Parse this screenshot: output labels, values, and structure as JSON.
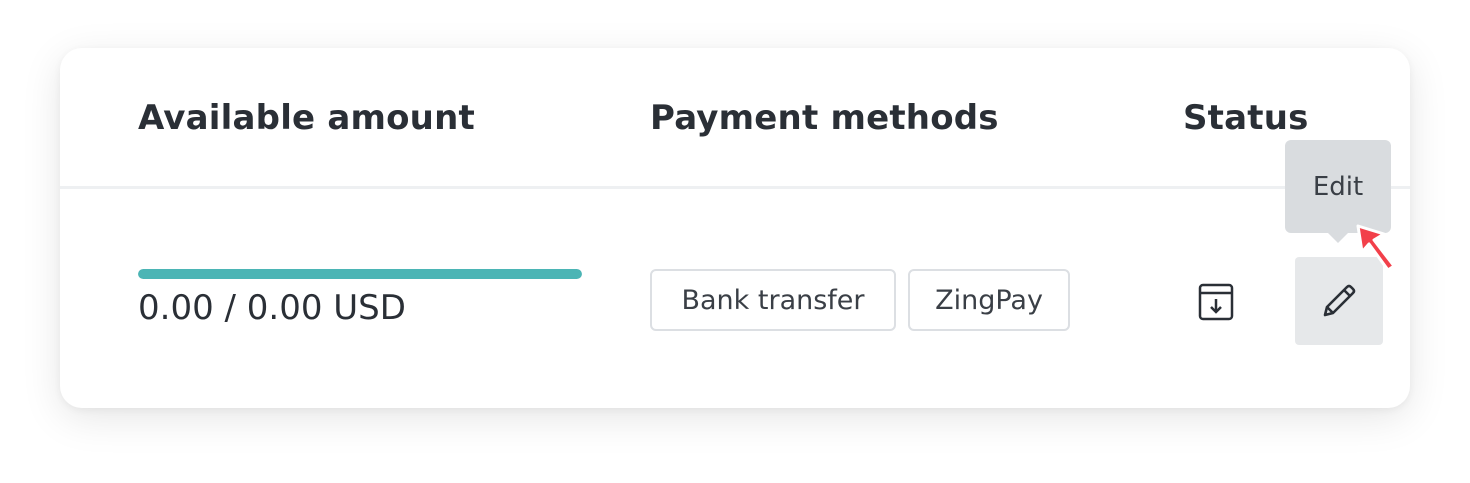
{
  "table": {
    "headers": {
      "amount": "Available amount",
      "methods": "Payment methods",
      "status": "Status"
    },
    "row": {
      "amount_text": "0.00 / 0.00 USD",
      "amount_progress_percent": 100,
      "payment_methods": [
        "Bank transfer",
        "ZingPay"
      ],
      "actions": {
        "archive_icon": "archive-download-icon",
        "edit_icon": "pencil-icon"
      }
    }
  },
  "tooltip": {
    "label": "Edit"
  },
  "colors": {
    "progress": "#4bb5b5",
    "cursor": "#f2404a",
    "tooltip_bg": "#d9dcdf",
    "button_bg": "#e6e8ea"
  }
}
